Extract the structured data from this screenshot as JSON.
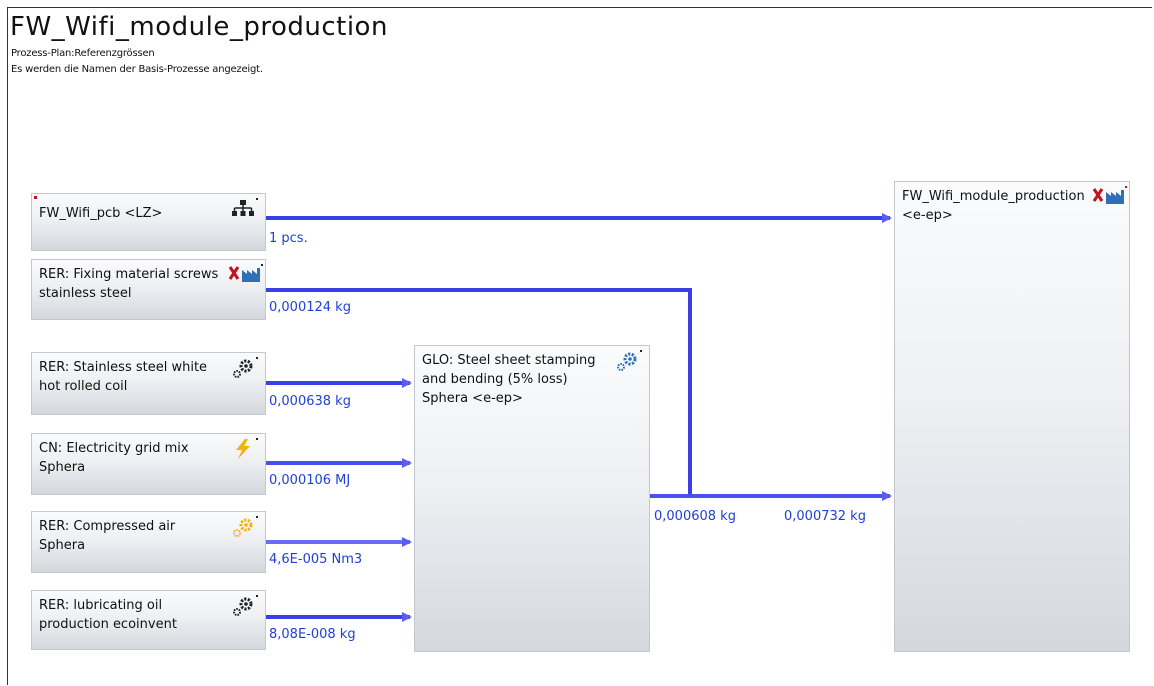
{
  "header": {
    "title": "FW_Wifi_module_production",
    "subtitle_1": "Prozess-Plan:Referenzgrössen",
    "subtitle_2": "Es werden die Namen der Basis-Prozesse angezeigt."
  },
  "processes": {
    "pcb": {
      "label": "FW_Wifi_pcb <LZ>",
      "icon": "hierarchy-icon"
    },
    "fixing": {
      "label": "RER: Fixing material screws stainless steel",
      "icon": "factory-x-icon"
    },
    "stainless": {
      "label": "RER: Stainless steel white hot rolled coil",
      "icon": "gear-icon"
    },
    "electricity": {
      "label": "CN: Electricity grid mix Sphera",
      "icon": "lightning-icon"
    },
    "air": {
      "label": "RER: Compressed air Sphera",
      "icon": "gear-yellow-icon"
    },
    "oil": {
      "label": "RER: lubricating oil production ecoinvent",
      "icon": "gear-icon"
    },
    "stamping": {
      "label": "GLO: Steel sheet stamping and bending (5% loss) Sphera <e-ep>",
      "icon": "gear-blue-icon"
    },
    "module": {
      "label": "FW_Wifi_module_production <e-ep>",
      "icon": "factory-x-icon"
    }
  },
  "flows": {
    "pcb_to_module": "1 pcs.",
    "fixing_to_module": "0,000124 kg",
    "stainless_to_stamping": "0,000638 kg",
    "electricity_to_stamping": "0,000106 MJ",
    "air_to_stamping": "4,6E-005 Nm3",
    "oil_to_stamping": "8,08E-008 kg",
    "stamping_out": "0,000608 kg",
    "module_in": "0,000732 kg"
  },
  "colors": {
    "flow_line": "#3a3fe6",
    "flow_text": "#1f3fd8",
    "factory_x": "#c0141c",
    "factory_blue": "#2e6fb5",
    "lightning": "#f2b400"
  }
}
